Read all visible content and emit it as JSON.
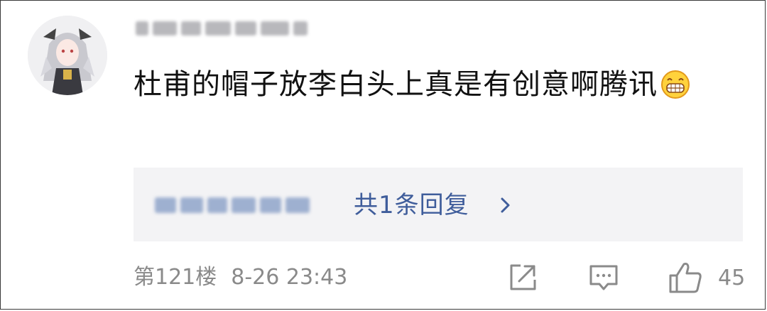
{
  "comment": {
    "text": "杜甫的帽子放李白头上真是有创意啊腾讯",
    "emoji": "grinning-face-icon"
  },
  "reply_preview": {
    "count_label": "共1条回复"
  },
  "meta": {
    "floor": "第121楼",
    "datetime": "8-26 23:43"
  },
  "actions": {
    "like_count": "45"
  },
  "colors": {
    "link_blue": "#3f5d9b",
    "meta_gray": "#8a8a8a",
    "reply_bg": "#f3f3f5"
  }
}
